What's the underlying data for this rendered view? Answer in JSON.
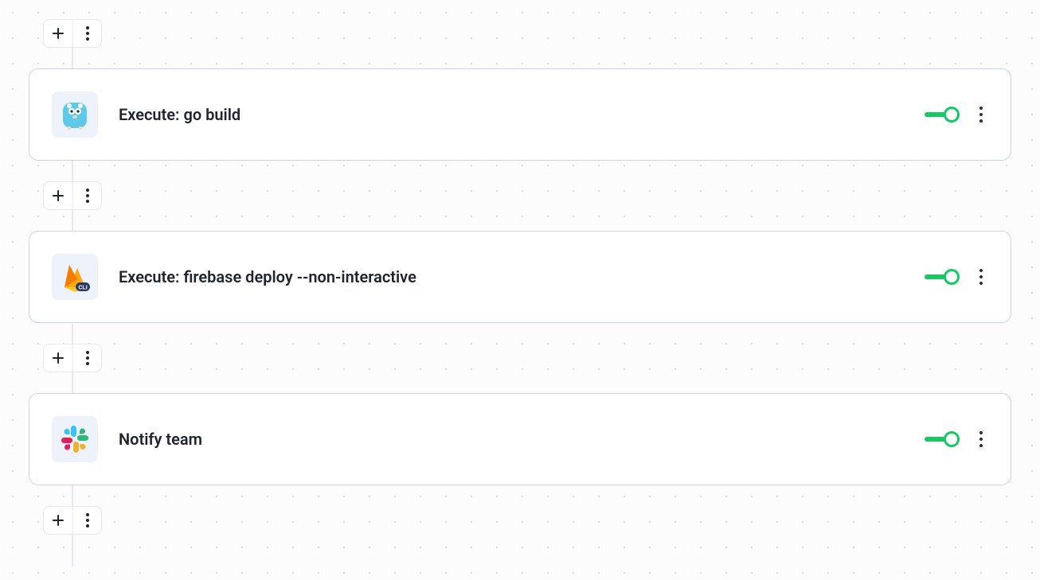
{
  "steps": [
    {
      "icon": "go",
      "title": "Execute: go build",
      "enabled": true
    },
    {
      "icon": "firebase",
      "title": "Execute: firebase deploy --non-interactive",
      "enabled": true
    },
    {
      "icon": "slack",
      "title": "Notify team",
      "enabled": true
    }
  ],
  "icons": {
    "plus": "plus-icon",
    "more": "more-vertical-icon"
  },
  "colors": {
    "card_border": "#c9d6f2",
    "toggle_on": "#17c964",
    "canvas_bg": "#fcfcfd"
  }
}
